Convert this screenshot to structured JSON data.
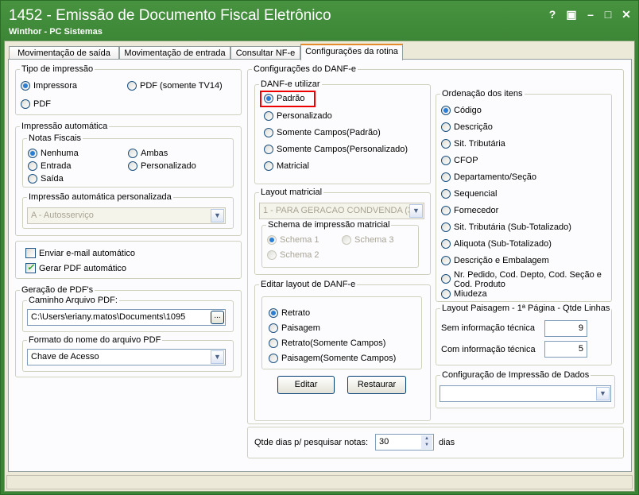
{
  "window": {
    "title": "1452 - Emissão de Documento Fiscal Eletrônico",
    "subtitle": "Winthor - PC Sistemas",
    "buttons": {
      "help": "?",
      "restore": "▣",
      "minimize": "–",
      "maximize": "□",
      "close": "✕"
    }
  },
  "tabs": [
    "Movimentação de saída",
    "Movimentação de entrada",
    "Consultar NF-e",
    "Configurações da rotina"
  ],
  "tipo_impressao": {
    "legend": "Tipo de impressão",
    "impressora": "Impressora",
    "pdf_tv14": "PDF (somente TV14)",
    "pdf": "PDF"
  },
  "impressao_automatica": {
    "legend": "Impressão automática",
    "notas_legend": "Notas Fiscais",
    "nenhuma": "Nenhuma",
    "ambas": "Ambas",
    "entrada": "Entrada",
    "personalizado": "Personalizado",
    "saida": "Saída",
    "personalizada_legend": "Impressão automática personalizada",
    "personalizada_value": "A - Autosserviço"
  },
  "checks": {
    "email": "Enviar e-mail automático",
    "gerar_pdf": "Gerar PDF automático"
  },
  "geracao_pdf": {
    "legend": "Geração de PDF's",
    "caminho_legend": "Caminho Arquivo PDF:",
    "caminho_value": "C:\\Users\\eriany.matos\\Documents\\1095",
    "browse": "...",
    "formato_legend": "Formato do nome do arquivo PDF",
    "formato_value": "Chave de Acesso"
  },
  "config_danfe": {
    "legend": "Configurações do DANF-e",
    "utilizar_legend": "DANF-e utilizar",
    "padrao": "Padrão",
    "personalizado": "Personalizado",
    "campos_padrao": "Somente Campos(Padrão)",
    "campos_personalizado": "Somente Campos(Personalizado)",
    "matricial": "Matricial",
    "layout_legend": "Layout matricial",
    "layout_value": "1 - PARA GERACAO CONDVENDA (3)",
    "schema_legend": "Schema de impressão matricial",
    "schema1": "Schema 1",
    "schema2": "Schema 2",
    "schema3": "Schema 3",
    "editar_legend": "Editar layout de DANF-e",
    "retrato": "Retrato",
    "paisagem": "Paisagem",
    "retrato_campos": "Retrato(Somente Campos)",
    "paisagem_campos": "Paisagem(Somente Campos)",
    "editar_btn": "Editar",
    "restaurar_btn": "Restaurar"
  },
  "ordenacao": {
    "legend": "Ordenação dos itens",
    "items": [
      "Código",
      "Descrição",
      "Sit. Tributária",
      "CFOP",
      "Departamento/Seção",
      "Sequencial",
      "Fornecedor",
      "Sit. Tributária (Sub-Totalizado)",
      "Aliquota (Sub-Totalizado)",
      "Descrição e Embalagem",
      "Nr. Pedido, Cod. Depto, Cod. Seção e",
      "Cod. Produto",
      "Miudeza"
    ]
  },
  "layout_paisagem": {
    "legend": "Layout Paisagem - 1ª Página - Qtde Linhas",
    "sem_label": "Sem informação técnica",
    "sem_value": "9",
    "com_label": "Com informação técnica",
    "com_value": "5"
  },
  "config_impressao": {
    "legend": "Configuração de Impressão de Dados",
    "value": ""
  },
  "qtde_dias": {
    "label": "Qtde dias p/ pesquisar notas:",
    "value": "30",
    "unit": "dias"
  },
  "colors": {
    "title_bar": "#3f8a3a",
    "highlight": "#ee0000",
    "active_tab_accent": "#e68b2c"
  }
}
